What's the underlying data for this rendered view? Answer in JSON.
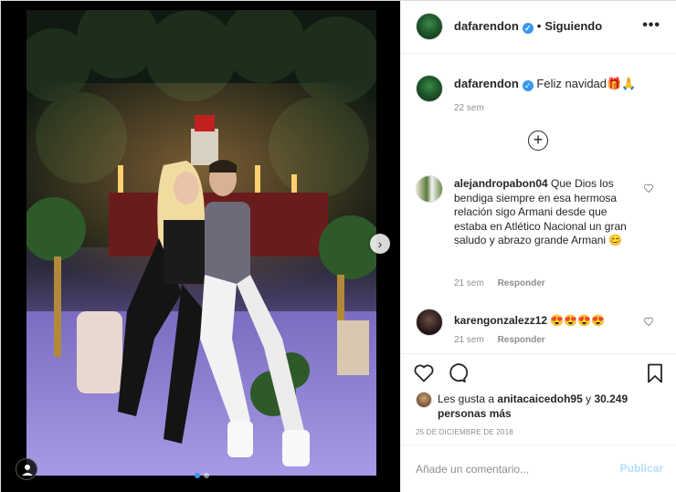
{
  "post": {
    "author": {
      "username": "dafarendon",
      "verified_icon": "verified-badge-icon",
      "separator": "•",
      "follow_status": "Siguiendo"
    },
    "more_label": "•••",
    "caption": {
      "username": "dafarendon",
      "text": "Feliz navidad🎁🙏",
      "time": "22 sem"
    },
    "load_more_label": "+",
    "comments": [
      {
        "username": "alejandropabon04",
        "text": "Que Dios los bendiga siempre en esa hermosa relación sigo Armani desde que estaba en Atlético Nacional un gran saludo y abrazo grande Armani 😊",
        "time": "21 sem",
        "reply_label": "Responder"
      },
      {
        "username": "karengonzalezz12",
        "text": "😍😍😍😍",
        "time": "21 sem",
        "reply_label": "Responder"
      }
    ],
    "likes": {
      "prefix": "Les gusta a ",
      "user": "anitacaicedoh95",
      "middle": " y ",
      "count": "30.249 personas más"
    },
    "date": "25 de diciembre de 2018",
    "add_comment": {
      "placeholder": "Añade un comentario...",
      "post_label": "Publicar"
    },
    "carousel": {
      "total": 2,
      "current": 1,
      "next_label": "›"
    },
    "colors": {
      "accent": "#3897f0",
      "publish_disabled": "#b2dffc",
      "muted": "#8e8e8e"
    }
  }
}
